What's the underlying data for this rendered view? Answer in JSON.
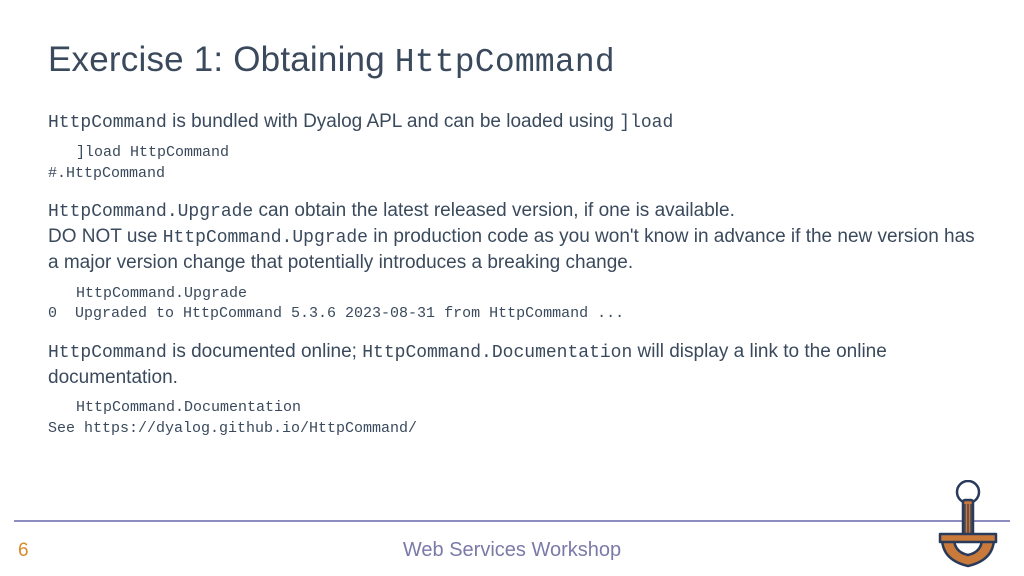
{
  "title": {
    "prefix": "Exercise 1: Obtaining ",
    "mono": "HttpCommand"
  },
  "p1": {
    "m1": "HttpCommand",
    "t1": " is bundled with Dyalog APL and can be loaded using ",
    "m2": "]load"
  },
  "code1": {
    "l1": "]load HttpCommand",
    "l2": "#.HttpCommand"
  },
  "p2": {
    "m1": "HttpCommand.Upgrade",
    "t1": " can obtain the latest released version, if one is available.",
    "t2": "DO NOT use ",
    "m2": "HttpCommand.Upgrade",
    "t3": " in production code as you won't know in advance if the new version has a major version change that potentially introduces a breaking change."
  },
  "code2": {
    "l1": "HttpCommand.Upgrade",
    "l2": "0  Upgraded to HttpCommand 5.3.6 2023-08-31 from HttpCommand ..."
  },
  "p3": {
    "m1": "HttpCommand",
    "t1": " is documented online; ",
    "m2": "HttpCommand.Documentation",
    "t2": " will display a link to the online documentation."
  },
  "code3": {
    "l1": "HttpCommand.Documentation",
    "l2": "See https://dyalog.github.io/HttpCommand/"
  },
  "footer": {
    "page": "6",
    "title": "Web Services Workshop"
  }
}
